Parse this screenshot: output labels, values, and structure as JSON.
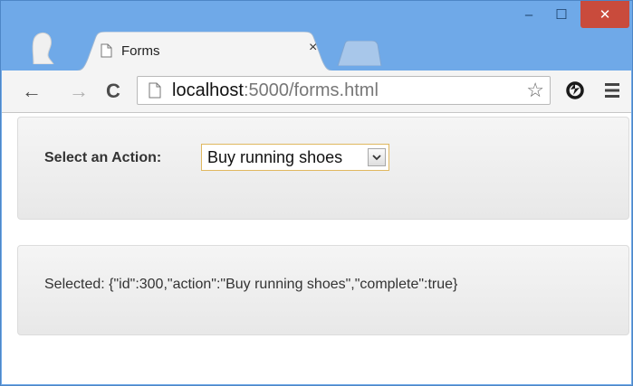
{
  "window": {
    "minimize_glyph": "–",
    "maximize_glyph": "☐",
    "close_glyph": "✕"
  },
  "tab": {
    "title": "Forms",
    "close_glyph": "×",
    "icon": "page-icon"
  },
  "toolbar": {
    "back_glyph": "←",
    "forward_glyph": "→",
    "reload_glyph": "C",
    "url_host": "localhost",
    "url_path": ":5000/forms.html",
    "star_glyph": "☆",
    "extension_icon": "sync-icon",
    "menu_icon": "hamburger-menu-icon"
  },
  "form": {
    "label": "Select an Action:",
    "selected_option": "Buy running shoes"
  },
  "result": {
    "text": "Selected: {\"id\":300,\"action\":\"Buy running shoes\",\"complete\":true}"
  },
  "colors": {
    "frame": "#6fa9e8",
    "close_button": "#c94b3c",
    "select_focus_border": "#e0b860"
  }
}
